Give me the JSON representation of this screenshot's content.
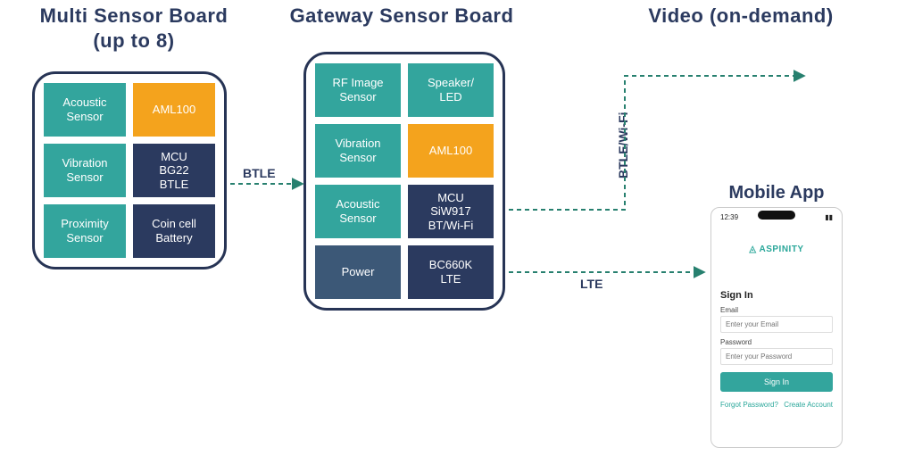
{
  "titles": {
    "multi": "Multi Sensor Board\n(up to 8)",
    "gateway": "Gateway Sensor Board",
    "video": "Video\n(on-demand)",
    "mobile": "Mobile App"
  },
  "multi": {
    "cells": [
      {
        "label": "Acoustic\nSensor",
        "color": "teal"
      },
      {
        "label": "AML100",
        "color": "orange"
      },
      {
        "label": "Vibration\nSensor",
        "color": "teal"
      },
      {
        "label": "MCU\nBG22\nBTLE",
        "color": "navy"
      },
      {
        "label": "Proximity\nSensor",
        "color": "teal"
      },
      {
        "label": "Coin cell\nBattery",
        "color": "navy"
      }
    ]
  },
  "gateway": {
    "cells": [
      {
        "label": "RF Image\nSensor",
        "color": "teal"
      },
      {
        "label": "Speaker/\nLED",
        "color": "teal"
      },
      {
        "label": "Vibration\nSensor",
        "color": "teal"
      },
      {
        "label": "AML100",
        "color": "orange"
      },
      {
        "label": "Acoustic\nSensor",
        "color": "teal"
      },
      {
        "label": "MCU\nSiW917\nBT/Wi-Fi",
        "color": "navy"
      },
      {
        "label": "Power",
        "color": "slate"
      },
      {
        "label": "BC660K\nLTE",
        "color": "navy"
      }
    ]
  },
  "connections": {
    "btle": "BTLE",
    "btle_wifi": "BTLE/Wi-Fi",
    "lte": "LTE"
  },
  "phone": {
    "time": "12:39",
    "logo": "ASPINITY",
    "signin": "Sign In",
    "email_label": "Email",
    "email_placeholder": "Enter your Email",
    "password_label": "Password",
    "password_placeholder": "Enter your Password",
    "signin_btn": "Sign In",
    "forgot": "Forgot Password?",
    "create": "Create Account"
  }
}
